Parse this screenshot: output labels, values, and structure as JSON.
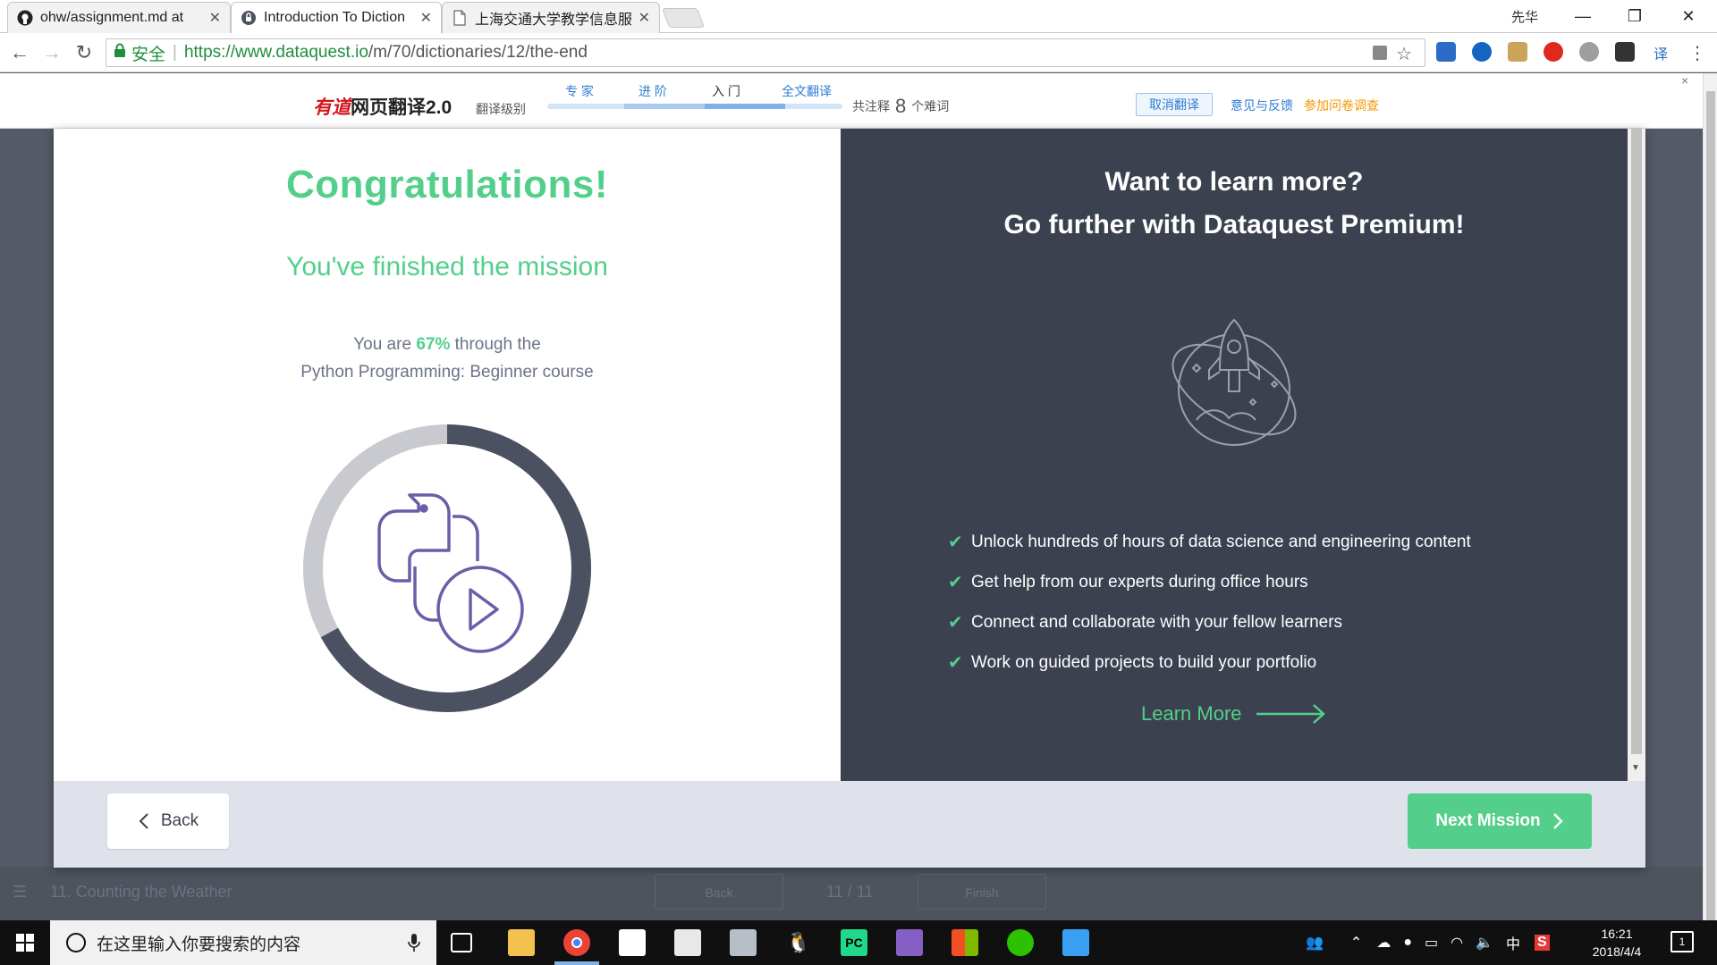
{
  "browser": {
    "tabs": [
      {
        "title": "ohw/assignment.md at",
        "icon": "github-icon"
      },
      {
        "title": "Introduction To Diction",
        "icon": "dataquest-icon"
      },
      {
        "title": "上海交通大学教学信息服",
        "icon": "page-icon"
      }
    ],
    "user": "先华",
    "secure_label": "安全",
    "url_host": "https://www.dataquest.io",
    "url_path": "/m/70/dictionaries/12/the-end"
  },
  "youdao": {
    "logo_brand": "有道",
    "logo_text": "网页翻译2.0",
    "level_label": "翻译级别",
    "levels": [
      "专 家",
      "进 阶",
      "入 门",
      "全文翻译"
    ],
    "count_prefix": "共注释",
    "count": "8",
    "count_suffix": "个难词",
    "cancel": "取消翻译",
    "feedback": "意见与反馈",
    "survey": "参加问卷调查",
    "close": "×"
  },
  "background": {
    "mission_title": "11. Counting the Weather",
    "back": "Back",
    "progress": "11 / 11",
    "finish": "Finish"
  },
  "modal": {
    "title": "Congratulations!",
    "subtitle": "You've finished the mission",
    "progress_prefix": "You are",
    "progress_pct": "67%",
    "progress_suffix": "through the",
    "course": "Python Programming: Beginner course",
    "progress_fraction": 0.67,
    "premium_line1": "Want to learn more?",
    "premium_line2": "Go further with Dataquest Premium!",
    "benefits": [
      "Unlock hundreds of hours of data science and engineering content",
      "Get help from our experts during office hours",
      "Connect and collaborate with your fellow learners",
      "Work on guided projects to build your portfolio"
    ],
    "learn_more": "Learn More",
    "back_button": "Back",
    "next_button": "Next Mission",
    "accent_color": "#53cf8b",
    "dark_color": "#3c4150"
  },
  "taskbar": {
    "search_placeholder": "在这里输入你要搜索的内容",
    "ime": "中",
    "time": "16:21",
    "date": "2018/4/4",
    "notifications": "1"
  }
}
